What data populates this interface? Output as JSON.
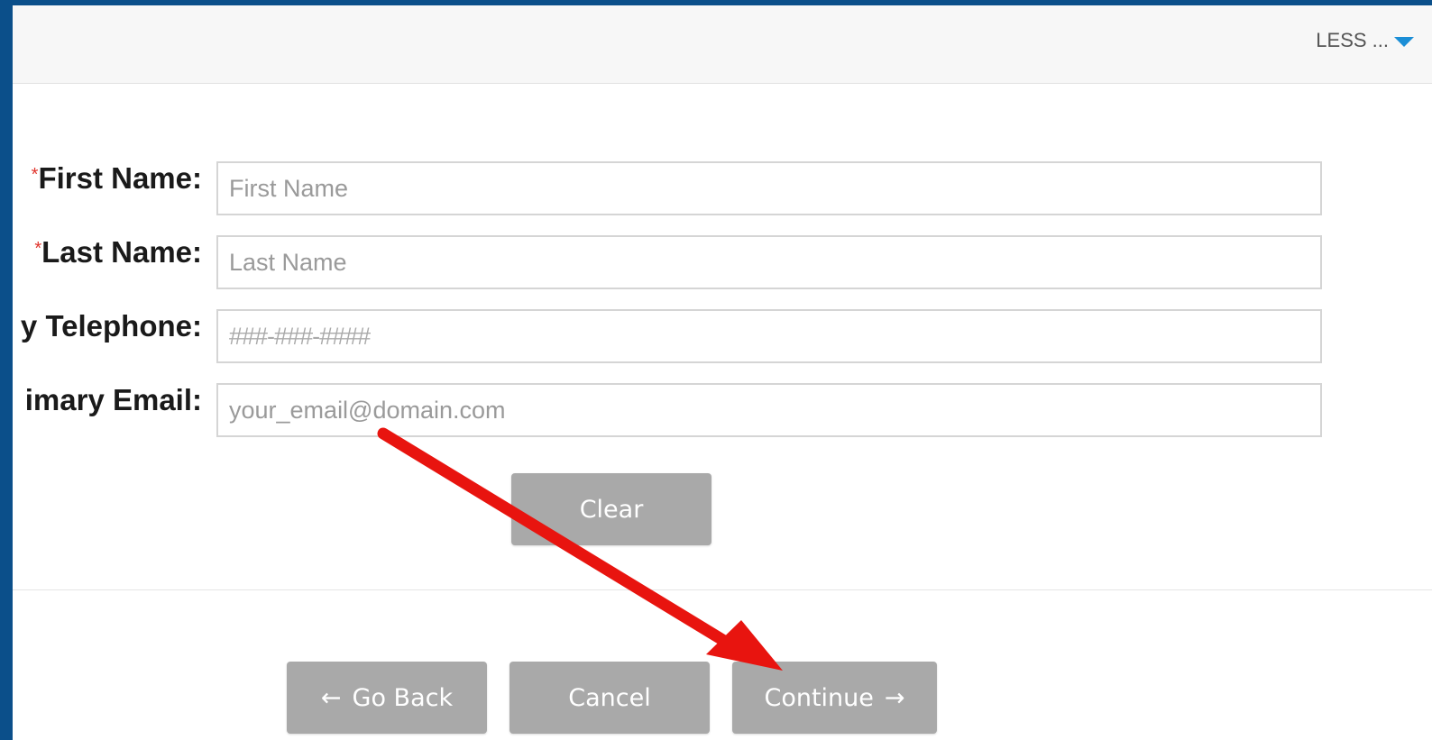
{
  "header": {
    "less_label": "LESS ..."
  },
  "form": {
    "fields": [
      {
        "label": "First Name:",
        "required": true,
        "required_marker": "*",
        "placeholder": "First Name",
        "value": ""
      },
      {
        "label": "Last Name:",
        "required": true,
        "required_marker": "*",
        "placeholder": "Last Name",
        "value": ""
      },
      {
        "label": "y Telephone:",
        "required": false,
        "placeholder": "###-###-####",
        "value": ""
      },
      {
        "label": "imary Email:",
        "required": false,
        "placeholder": "your_email@domain.com",
        "value": ""
      }
    ],
    "clear_label": "Clear"
  },
  "footer": {
    "go_back_label": "Go Back",
    "cancel_label": "Cancel",
    "continue_label": "Continue"
  },
  "icons": {
    "go_back": "arrow-left-icon",
    "continue": "arrow-right-icon",
    "less_toggle": "caret-down-icon"
  },
  "colors": {
    "frame": "#0b4f8a",
    "button": "#a9a9a9",
    "required": "#e0342c",
    "caret": "#1b8ed6",
    "annotation_arrow": "#e8140f"
  }
}
